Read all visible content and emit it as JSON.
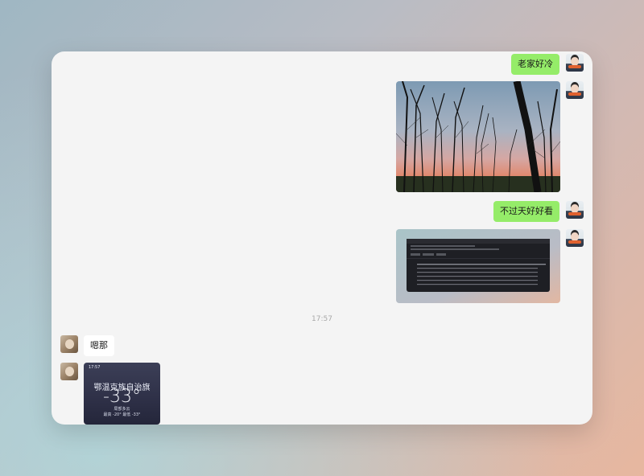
{
  "messages": {
    "m1_text": "老家好冷",
    "m3_text": "不过天好好看",
    "timestamp": "17:57",
    "m5_text": "嗯那"
  },
  "weather": {
    "status_time": "17:57",
    "city": "鄂温克族自治旗",
    "temperature": "-33°",
    "condition": "局部多云",
    "range": "最高 -20° 最低 -33°"
  },
  "colors": {
    "self_bubble": "#95ec69",
    "other_bubble": "#ffffff",
    "chat_background": "#f4f4f4"
  }
}
